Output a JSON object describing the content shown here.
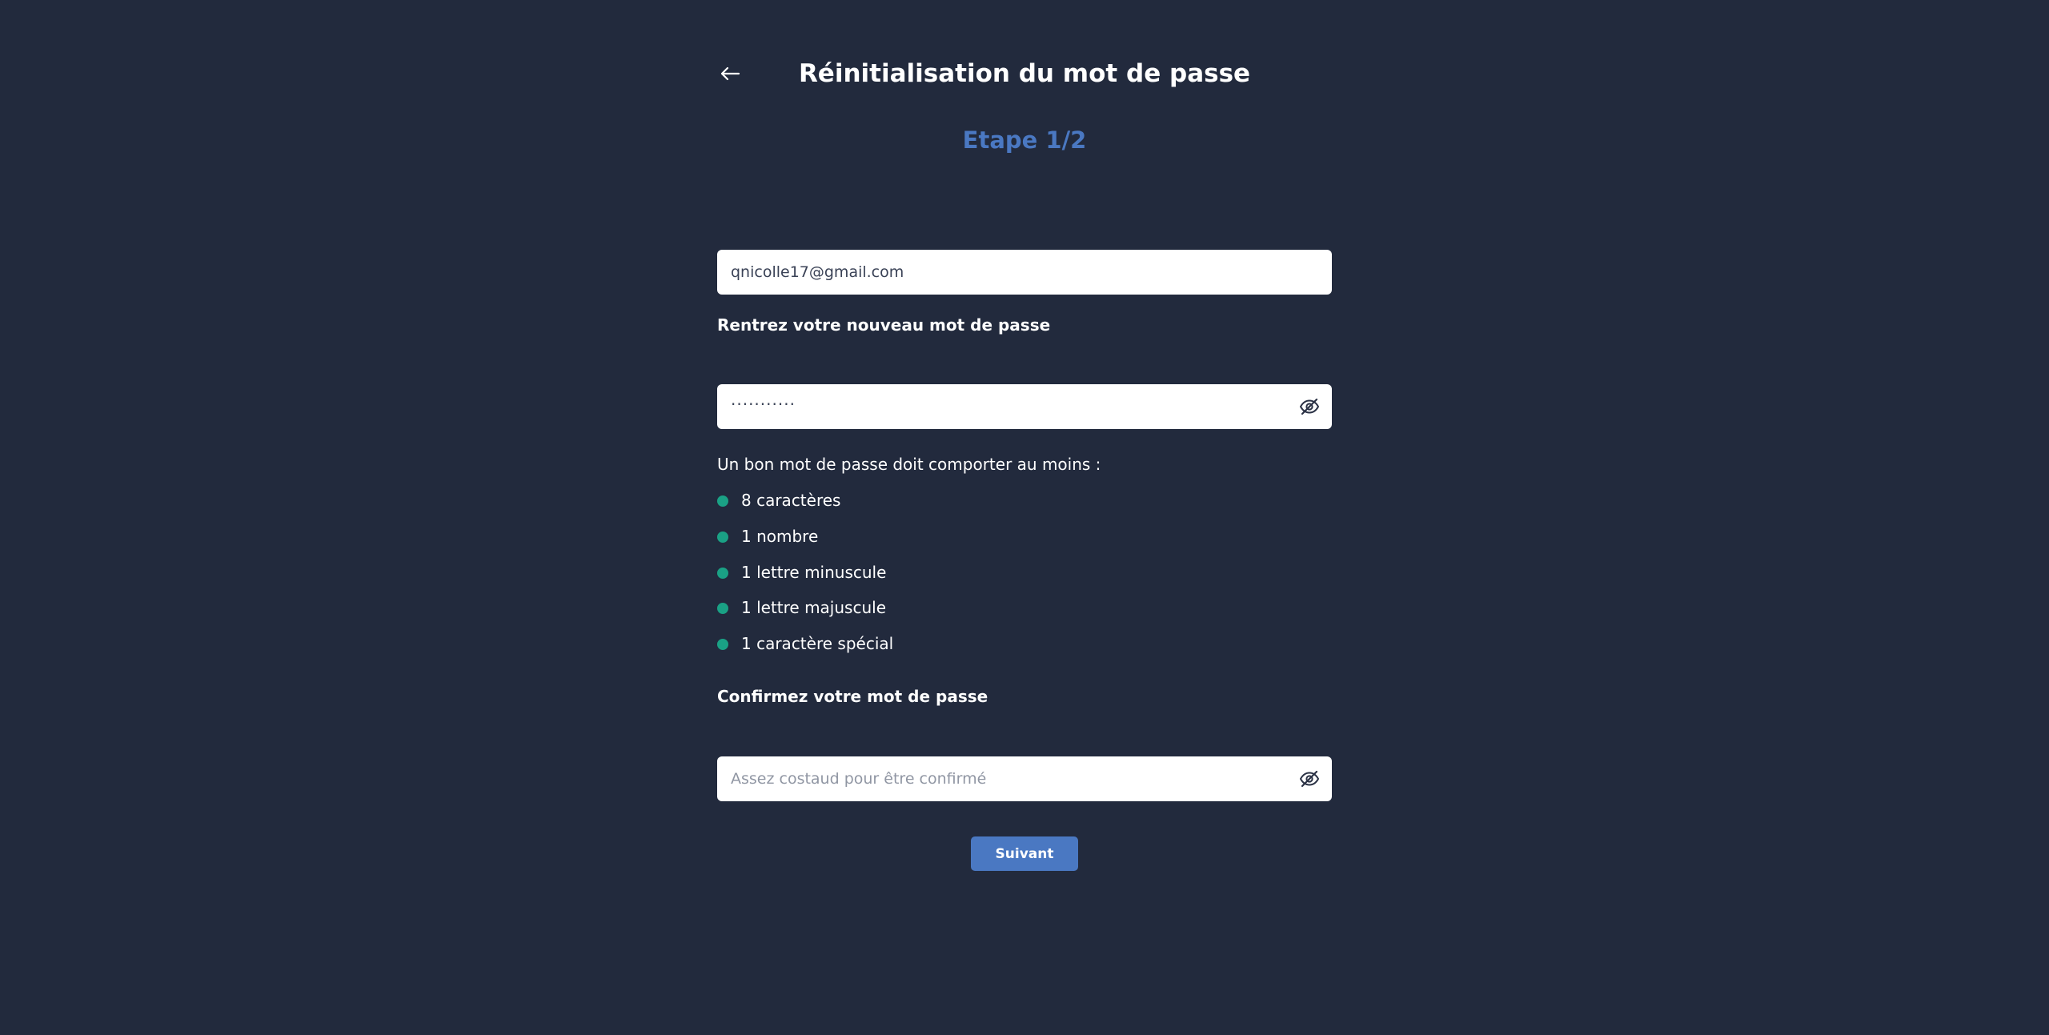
{
  "header": {
    "title": "Réinitialisation du mot de passe",
    "back_icon": "arrow-left-icon"
  },
  "step": {
    "label": "Etape 1/2"
  },
  "email_field": {
    "value": "qnicolle17@gmail.com"
  },
  "new_password": {
    "label": "Rentrez votre nouveau mot de passe",
    "masked_value": "···········",
    "toggle_icon": "eye-off-icon"
  },
  "rules": {
    "intro": "Un bon mot de passe doit comporter au moins :",
    "items": [
      {
        "label": "8 caractères",
        "status_color": "#1aa185"
      },
      {
        "label": "1 nombre",
        "status_color": "#1aa185"
      },
      {
        "label": "1 lettre minuscule",
        "status_color": "#1aa185"
      },
      {
        "label": "1 lettre majuscule",
        "status_color": "#1aa185"
      },
      {
        "label": "1 caractère spécial",
        "status_color": "#1aa185"
      }
    ]
  },
  "confirm_password": {
    "label": "Confirmez votre mot de passe",
    "placeholder": "Assez costaud pour être confirmé",
    "toggle_icon": "eye-off-icon"
  },
  "actions": {
    "next_label": "Suivant"
  },
  "colors": {
    "background": "#222a3d",
    "accent": "#4a78c2",
    "valid": "#1aa185",
    "input_background": "#ffffff"
  }
}
